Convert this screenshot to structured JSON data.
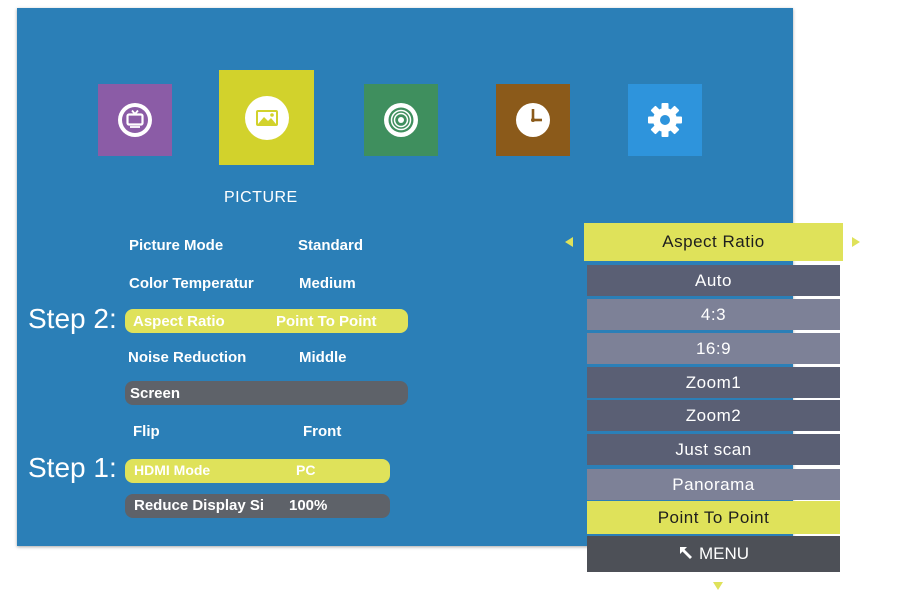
{
  "colors": {
    "screen_bg": "#2b7fb7",
    "tile_tv": "#8b5ca6",
    "tile_picture": "#d2d22c",
    "tile_sound": "#3f8f5e",
    "tile_time": "#8b5a1a",
    "tile_settings": "#2e94dc",
    "highlight": "#dfe25a",
    "row_gray": "#5e6269"
  },
  "icons": [
    "tv-icon",
    "picture-icon",
    "sound-disc-icon",
    "clock-icon",
    "gear-icon"
  ],
  "section_title": "PICTURE",
  "settings": [
    {
      "label": "Picture Mode",
      "value": "Standard"
    },
    {
      "label": "Color Temperatur",
      "value": "Medium"
    },
    {
      "label": "Aspect Ratio",
      "value": "Point To Point"
    },
    {
      "label": "Noise Reduction",
      "value": "Middle"
    },
    {
      "label": "Screen",
      "value": ""
    },
    {
      "label": "Flip",
      "value": "Front"
    },
    {
      "label": "HDMI Mode",
      "value": "PC"
    },
    {
      "label": "Reduce Display Si",
      "value": "100%"
    }
  ],
  "steps": {
    "step2": "Step 2:",
    "step1": "Step 1:"
  },
  "popup": {
    "title": "Aspect Ratio",
    "options": [
      "Auto",
      "4:3",
      "16:9",
      "Zoom1",
      "Zoom2",
      "Just scan",
      "Panorama",
      "Point To Point"
    ],
    "selected": "Point To Point",
    "menu_label": "MENU"
  }
}
